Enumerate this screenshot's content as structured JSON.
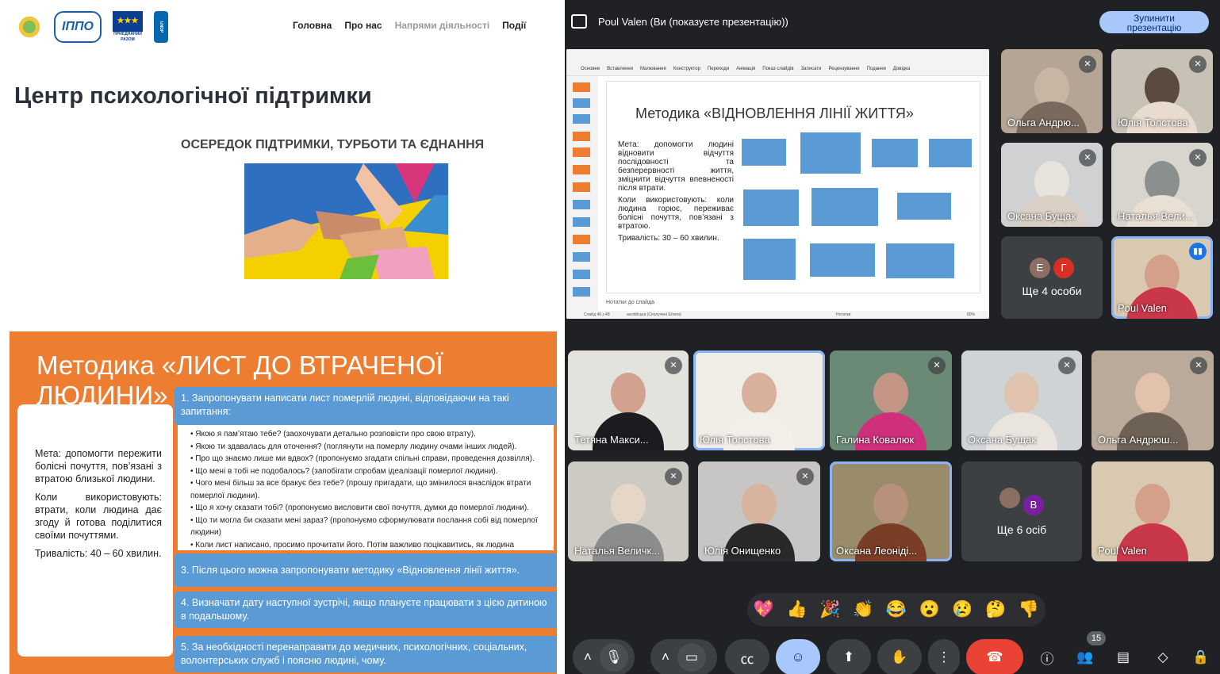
{
  "website": {
    "logos": [
      "ІППО",
      "ПРИЄДНАНИЙ РАЗОМ",
      "UNDP"
    ],
    "nav": [
      "Головна",
      "Про нас",
      "Напрями діяльності",
      "Події"
    ],
    "title": "Центр психологічної підтримки",
    "subtitle": "ОСЕРЕДОК ПІДТРИМКИ, ТУРБОТИ ТА ЄДНАННЯ"
  },
  "slide_letter": {
    "title": "Методика «ЛИСТ ДО ВТРАЧЕНОЇ ЛЮДИНИ»",
    "left_text": [
      "Мета: допомогти пережити болісні почуття, пов’язані з втратою близької людини.",
      "Коли використовують: втрати, коли людина дає згоду й готова поділитися своїми почуттями.",
      "Тривалість: 40 – 60 хвилин."
    ],
    "step1": "1. Запропонувати написати лист померлій людині, відповідаючи на такі запитання:",
    "questions": [
      "Якою я пам’ятаю тебе? (заохочувати детально розповісти про свою втрату).",
      "Якою ти здавалась для оточення? (поглянути на померлу людину очами інших людей).",
      "Про що знаємо лише ми вдвох? (пропонуємо згадати спільні справи, проведення дозвілля).",
      "Що мені в тобі не подобалось? (запобігати спробам ідеалізації померлої людини).",
      "Чого мені більш за все бракує без тебе? (прошу пригадати, що змінилося внаслідок втрати померлої людини).",
      "Що я хочу сказати тобі? (пропонуємо висловити свої почуття, думки до померлої людини).",
      "Що ти могла би сказати мені зараз? (пропонуємо сформулювати послання собі від померлої людини)",
      "Коли лист написано, просимо прочитати його. Потім важливо поцікавитись, як людина почувається, дати можливість висловити емоції."
    ],
    "step3": "3. Після цього можна запропонувати методику «Відновлення лінії життя».",
    "step4": "4. Визначати дату наступної зустрічі, якщо плануєте працювати з цією дитиною в подальшому.",
    "step5": "5. За необхідності перенаправити до медичних, психологічних, соціальних, волонтерських служб і поясню людині, чому."
  },
  "meet": {
    "presenter": "Poul Valen (Ви (показуєте презентацію))",
    "stop_label_1": "Зупинити",
    "stop_label_2": "презентацію",
    "participant_count": "15",
    "shared_slide": {
      "menu": [
        "Основне",
        "Вставлення",
        "Малювання",
        "Конструктор",
        "Переходи",
        "Анімація",
        "Показ слайдів",
        "Записати",
        "Рецензування",
        "Подання",
        "Довідка"
      ],
      "title": "Методика «ВІДНОВЛЕННЯ ЛІНІЇ ЖИТТЯ»",
      "bullets": [
        "Мета: допомогти людині відновити відчуття послідовності та безперервності життя, зміцнити відчуття впевненості після втрати.",
        "Коли використовують: коли людина горює, переживає болісні почуття, пов’язані з втратою.",
        "Тривалість: 30 – 60 хвилин."
      ],
      "notes": "Нотатки до слайда",
      "status": "Слайд 46 з 48",
      "language": "англійська (Сполучені Штати)",
      "notes_btn": "Нотатки",
      "zoom": "80%"
    },
    "top_tiles": [
      {
        "name": "Ольга Андрю...",
        "muted": true,
        "c1": "#7a6a5e",
        "c2": "#c8b5a4",
        "bg": "#b4a595"
      },
      {
        "name": "Юлія Толстова",
        "muted": true,
        "c1": "#e9dccf",
        "c2": "#5a4a3f",
        "bg": "#c7c1b6"
      },
      {
        "name": "Оксана Бущак",
        "muted": true,
        "c1": "#d9cfc4",
        "c2": "#e8e4dd",
        "bg": "#cfd1d2"
      },
      {
        "name": "Наталья Вели...",
        "muted": true,
        "c1": "#eadfd3",
        "c2": "#8b8f8e",
        "bg": "#d8d5cf"
      }
    ],
    "more_top": "Ще 4 особи",
    "more_top_avatars": [
      "Е",
      "Г"
    ],
    "me_tile": "Poul Valen",
    "grid": [
      {
        "name": "Тетяна Макси...",
        "muted": true,
        "bg": "#e4e2dd",
        "c1": "#d2a28f",
        "c2": "#1c1b1f"
      },
      {
        "name": "Юлія Толстова",
        "muted": false,
        "bg": "#f0ece6",
        "c1": "#d7b19b",
        "c2": "#f2efe9"
      },
      {
        "name": "Галина Ковалюк",
        "muted": true,
        "bg": "#6a8a76",
        "c1": "#c49485",
        "c2": "#d02f7c"
      },
      {
        "name": "Оксана Бущак",
        "muted": true,
        "bg": "#cfd3d6",
        "c1": "#e0c3ae",
        "c2": "#e9e5de"
      },
      {
        "name": "Ольга Андрюш...",
        "muted": true,
        "bg": "#b9aa9a",
        "c1": "#e2c2ab",
        "c2": "#6e6156"
      },
      {
        "name": "Наталья Величк...",
        "muted": true,
        "bg": "#cdcac3",
        "c1": "#e6d6c7",
        "c2": "#8a8d8b"
      },
      {
        "name": "Юлія Онищенко",
        "muted": true,
        "bg": "#c8c6c4",
        "c1": "#d8b39d",
        "c2": "#2a2829"
      },
      {
        "name": "Оксана Леоніді...",
        "muted": false,
        "bg": "#9a8c6a",
        "c1": "#b8917a",
        "c2": "#7a3d26"
      },
      {
        "name": "Poul Valen",
        "muted": false,
        "bg": "#d9c9b0",
        "c1": "#d4a08a",
        "c2": "#c8374a"
      }
    ],
    "more_grid": "Ще 6 осіб",
    "more_grid_avatar": "В",
    "reactions": [
      "💖",
      "👍",
      "🎉",
      "👏",
      "😂",
      "😮",
      "😢",
      "🤔",
      "👎"
    ]
  }
}
